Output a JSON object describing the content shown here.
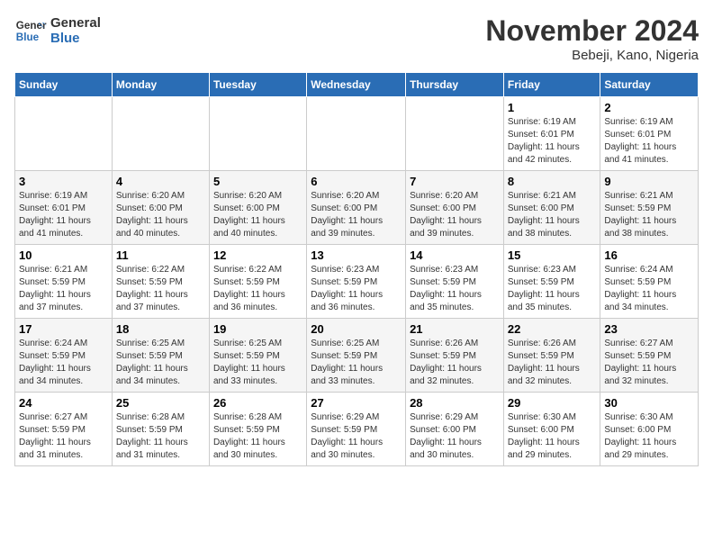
{
  "logo": {
    "line1": "General",
    "line2": "Blue"
  },
  "title": "November 2024",
  "subtitle": "Bebeji, Kano, Nigeria",
  "days_of_week": [
    "Sunday",
    "Monday",
    "Tuesday",
    "Wednesday",
    "Thursday",
    "Friday",
    "Saturday"
  ],
  "weeks": [
    [
      {
        "day": "",
        "info": ""
      },
      {
        "day": "",
        "info": ""
      },
      {
        "day": "",
        "info": ""
      },
      {
        "day": "",
        "info": ""
      },
      {
        "day": "",
        "info": ""
      },
      {
        "day": "1",
        "info": "Sunrise: 6:19 AM\nSunset: 6:01 PM\nDaylight: 11 hours\nand 42 minutes."
      },
      {
        "day": "2",
        "info": "Sunrise: 6:19 AM\nSunset: 6:01 PM\nDaylight: 11 hours\nand 41 minutes."
      }
    ],
    [
      {
        "day": "3",
        "info": "Sunrise: 6:19 AM\nSunset: 6:01 PM\nDaylight: 11 hours\nand 41 minutes."
      },
      {
        "day": "4",
        "info": "Sunrise: 6:20 AM\nSunset: 6:00 PM\nDaylight: 11 hours\nand 40 minutes."
      },
      {
        "day": "5",
        "info": "Sunrise: 6:20 AM\nSunset: 6:00 PM\nDaylight: 11 hours\nand 40 minutes."
      },
      {
        "day": "6",
        "info": "Sunrise: 6:20 AM\nSunset: 6:00 PM\nDaylight: 11 hours\nand 39 minutes."
      },
      {
        "day": "7",
        "info": "Sunrise: 6:20 AM\nSunset: 6:00 PM\nDaylight: 11 hours\nand 39 minutes."
      },
      {
        "day": "8",
        "info": "Sunrise: 6:21 AM\nSunset: 6:00 PM\nDaylight: 11 hours\nand 38 minutes."
      },
      {
        "day": "9",
        "info": "Sunrise: 6:21 AM\nSunset: 5:59 PM\nDaylight: 11 hours\nand 38 minutes."
      }
    ],
    [
      {
        "day": "10",
        "info": "Sunrise: 6:21 AM\nSunset: 5:59 PM\nDaylight: 11 hours\nand 37 minutes."
      },
      {
        "day": "11",
        "info": "Sunrise: 6:22 AM\nSunset: 5:59 PM\nDaylight: 11 hours\nand 37 minutes."
      },
      {
        "day": "12",
        "info": "Sunrise: 6:22 AM\nSunset: 5:59 PM\nDaylight: 11 hours\nand 36 minutes."
      },
      {
        "day": "13",
        "info": "Sunrise: 6:23 AM\nSunset: 5:59 PM\nDaylight: 11 hours\nand 36 minutes."
      },
      {
        "day": "14",
        "info": "Sunrise: 6:23 AM\nSunset: 5:59 PM\nDaylight: 11 hours\nand 35 minutes."
      },
      {
        "day": "15",
        "info": "Sunrise: 6:23 AM\nSunset: 5:59 PM\nDaylight: 11 hours\nand 35 minutes."
      },
      {
        "day": "16",
        "info": "Sunrise: 6:24 AM\nSunset: 5:59 PM\nDaylight: 11 hours\nand 34 minutes."
      }
    ],
    [
      {
        "day": "17",
        "info": "Sunrise: 6:24 AM\nSunset: 5:59 PM\nDaylight: 11 hours\nand 34 minutes."
      },
      {
        "day": "18",
        "info": "Sunrise: 6:25 AM\nSunset: 5:59 PM\nDaylight: 11 hours\nand 34 minutes."
      },
      {
        "day": "19",
        "info": "Sunrise: 6:25 AM\nSunset: 5:59 PM\nDaylight: 11 hours\nand 33 minutes."
      },
      {
        "day": "20",
        "info": "Sunrise: 6:25 AM\nSunset: 5:59 PM\nDaylight: 11 hours\nand 33 minutes."
      },
      {
        "day": "21",
        "info": "Sunrise: 6:26 AM\nSunset: 5:59 PM\nDaylight: 11 hours\nand 32 minutes."
      },
      {
        "day": "22",
        "info": "Sunrise: 6:26 AM\nSunset: 5:59 PM\nDaylight: 11 hours\nand 32 minutes."
      },
      {
        "day": "23",
        "info": "Sunrise: 6:27 AM\nSunset: 5:59 PM\nDaylight: 11 hours\nand 32 minutes."
      }
    ],
    [
      {
        "day": "24",
        "info": "Sunrise: 6:27 AM\nSunset: 5:59 PM\nDaylight: 11 hours\nand 31 minutes."
      },
      {
        "day": "25",
        "info": "Sunrise: 6:28 AM\nSunset: 5:59 PM\nDaylight: 11 hours\nand 31 minutes."
      },
      {
        "day": "26",
        "info": "Sunrise: 6:28 AM\nSunset: 5:59 PM\nDaylight: 11 hours\nand 30 minutes."
      },
      {
        "day": "27",
        "info": "Sunrise: 6:29 AM\nSunset: 5:59 PM\nDaylight: 11 hours\nand 30 minutes."
      },
      {
        "day": "28",
        "info": "Sunrise: 6:29 AM\nSunset: 6:00 PM\nDaylight: 11 hours\nand 30 minutes."
      },
      {
        "day": "29",
        "info": "Sunrise: 6:30 AM\nSunset: 6:00 PM\nDaylight: 11 hours\nand 29 minutes."
      },
      {
        "day": "30",
        "info": "Sunrise: 6:30 AM\nSunset: 6:00 PM\nDaylight: 11 hours\nand 29 minutes."
      }
    ]
  ]
}
